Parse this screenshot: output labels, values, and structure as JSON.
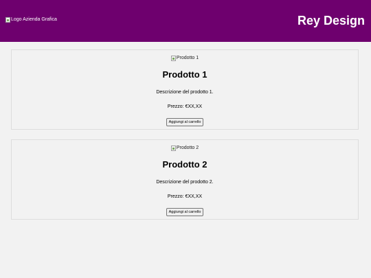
{
  "header": {
    "logo_alt": "Logo Azienda Grafica",
    "brand": "Rey Design"
  },
  "products": [
    {
      "image_alt": "Prodotto 1",
      "title": "Prodotto 1",
      "description": "Descrizione del prodotto 1.",
      "price": "Prezzo: €XX,XX",
      "button_label": "Aggiungi al carrello"
    },
    {
      "image_alt": "Prodotto 2",
      "title": "Prodotto 2",
      "description": "Descrizione del prodotto 2.",
      "price": "Prezzo: €XX,XX",
      "button_label": "Aggiungi al carrello"
    }
  ],
  "colors": {
    "header_bg": "#6e006e",
    "page_bg": "#f2f2f2"
  }
}
